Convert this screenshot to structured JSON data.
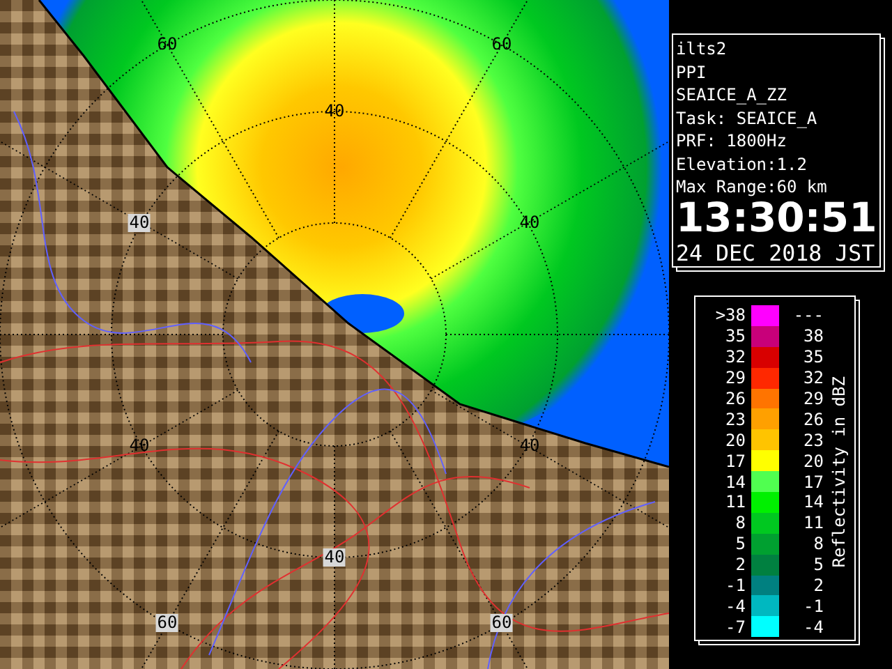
{
  "radar": {
    "range_labels": [
      "60",
      "60",
      "40",
      "40",
      "40",
      "40",
      "40",
      "40",
      "60",
      "60"
    ]
  },
  "station": {
    "lines": [
      "ilts2",
      "PPI",
      "SEAICE_A_ZZ",
      "Task: SEAICE_A",
      "PRF: 1800Hz",
      "Elevation:1.2",
      "Max Range:60 km"
    ],
    "time": "13:30:51",
    "date": "24 DEC 2018 JST"
  },
  "legend": {
    "title": "Reflectivity in dBZ",
    "entries": [
      {
        "low": ">38",
        "high": "---",
        "color": "#ff00ff"
      },
      {
        "low": "35",
        "high": "38",
        "color": "#c8007a"
      },
      {
        "low": "32",
        "high": "35",
        "color": "#d80000"
      },
      {
        "low": "29",
        "high": "32",
        "color": "#ff2800"
      },
      {
        "low": "26",
        "high": "29",
        "color": "#ff7400"
      },
      {
        "low": "23",
        "high": "26",
        "color": "#ffa000"
      },
      {
        "low": "20",
        "high": "23",
        "color": "#ffc400"
      },
      {
        "low": "17",
        "high": "20",
        "color": "#ffff00"
      },
      {
        "low": "14",
        "high": "17",
        "color": "#50ff50"
      },
      {
        "low": "11",
        "high": "14",
        "color": "#00f000"
      },
      {
        "low": "8",
        "high": "11",
        "color": "#00c820"
      },
      {
        "low": "5",
        "high": "8",
        "color": "#00a030"
      },
      {
        "low": "2",
        "high": "5",
        "color": "#008040"
      },
      {
        "low": "-1",
        "high": "2",
        "color": "#008080"
      },
      {
        "low": "-4",
        "high": "-1",
        "color": "#00b8c0"
      },
      {
        "low": "-7",
        "high": "-4",
        "color": "#00ffff"
      }
    ]
  }
}
